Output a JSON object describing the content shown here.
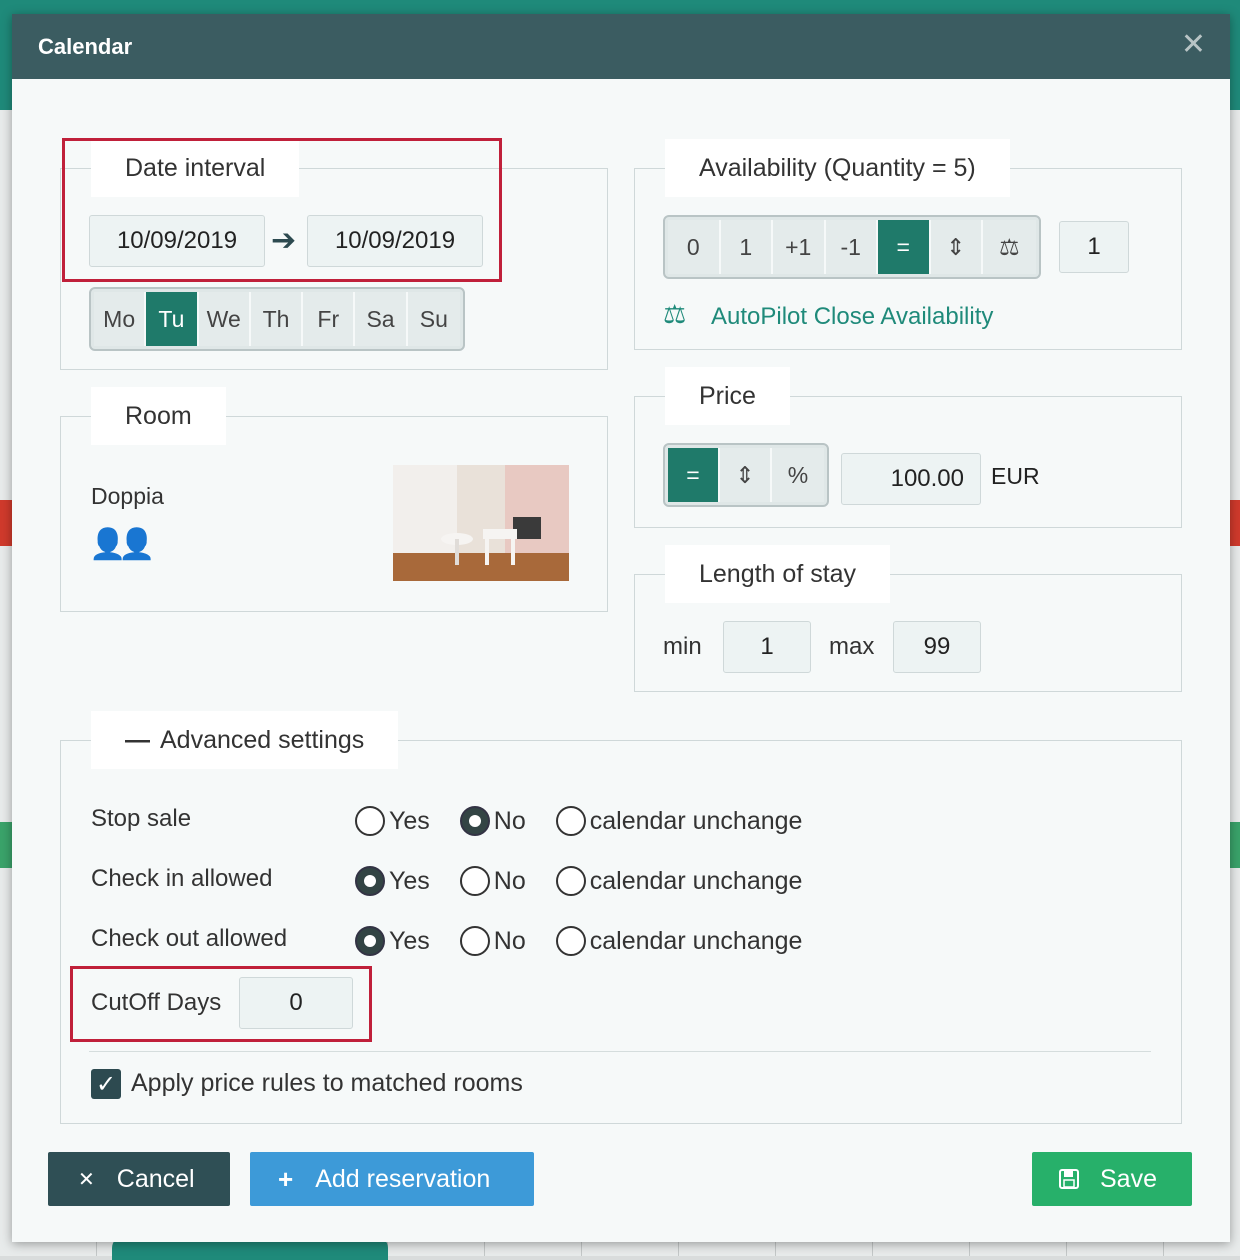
{
  "modal": {
    "title": "Calendar"
  },
  "date_interval": {
    "legend": "Date interval",
    "from": "10/09/2019",
    "to": "10/09/2019",
    "days": [
      {
        "label": "Mo",
        "active": false
      },
      {
        "label": "Tu",
        "active": true
      },
      {
        "label": "We",
        "active": false
      },
      {
        "label": "Th",
        "active": false
      },
      {
        "label": "Fr",
        "active": false
      },
      {
        "label": "Sa",
        "active": false
      },
      {
        "label": "Su",
        "active": false
      }
    ]
  },
  "availability": {
    "legend": "Availability (Quantity = 5)",
    "ops": [
      {
        "label": "0",
        "active": false
      },
      {
        "label": "1",
        "active": false
      },
      {
        "label": "+1",
        "active": false
      },
      {
        "label": "-1",
        "active": false
      },
      {
        "label": "=",
        "active": true
      },
      {
        "label": "⇕",
        "active": false
      },
      {
        "label": "⚖",
        "active": false
      }
    ],
    "value": "1",
    "autopilot_label": "AutoPilot Close Availability"
  },
  "room": {
    "legend": "Room",
    "name": "Doppia",
    "occupancy_icons": "two-persons-icon"
  },
  "price": {
    "legend": "Price",
    "ops": [
      {
        "label": "=",
        "active": true
      },
      {
        "label": "⇕",
        "active": false
      },
      {
        "label": "%",
        "active": false
      }
    ],
    "value": "100.00",
    "currency": "EUR"
  },
  "length_of_stay": {
    "legend": "Length of stay",
    "min_label": "min",
    "min_value": "1",
    "max_label": "max",
    "max_value": "99"
  },
  "advanced": {
    "legend": "Advanced settings",
    "rows": [
      {
        "label": "Stop sale",
        "selected": "No"
      },
      {
        "label": "Check in allowed",
        "selected": "Yes"
      },
      {
        "label": "Check out allowed",
        "selected": "Yes"
      }
    ],
    "options": [
      "Yes",
      "No",
      "calendar unchange"
    ],
    "cutoff_label": "CutOff Days",
    "cutoff_value": "0",
    "apply_rules_label": "Apply price rules to matched rooms",
    "apply_rules_checked": true
  },
  "footer": {
    "cancel_label": "Cancel",
    "add_reservation_label": "Add reservation",
    "save_label": "Save"
  },
  "colors": {
    "header": "#3b5c61",
    "accent": "#1f7a6a",
    "cancel": "#2f4f55",
    "add": "#3d9ad8",
    "save": "#27b06a",
    "highlight": "#c0203a"
  }
}
